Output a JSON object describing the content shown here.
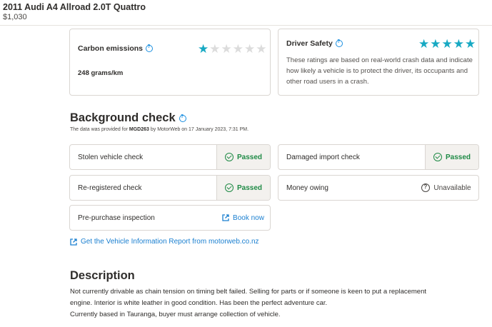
{
  "header": {
    "title": "2011 Audi A4 Allroad 2.0T Quattro",
    "price": "$1,030"
  },
  "ratings": {
    "carbon": {
      "title": "Carbon emissions",
      "value": "248 grams/km",
      "stars_filled": 1,
      "stars_total": 6
    },
    "safety": {
      "title": "Driver Safety",
      "stars_filled": 5,
      "stars_total": 5,
      "description": "These ratings are based on real-world crash data and indicate how likely a vehicle is to protect the driver, its occupants and other road users in a crash."
    }
  },
  "background_check": {
    "title": "Background check",
    "provided_prefix": "The data was provided for ",
    "plate": "MGD263",
    "provided_suffix": " by MotorWeb on 17 January 2023, 7:31 PM.",
    "items": {
      "stolen": {
        "label": "Stolen vehicle check",
        "status": "Passed"
      },
      "damaged": {
        "label": "Damaged import check",
        "status": "Passed"
      },
      "reregistered": {
        "label": "Re-registered check",
        "status": "Passed"
      },
      "money": {
        "label": "Money owing",
        "status": "Unavailable"
      },
      "inspection": {
        "label": "Pre-purchase inspection",
        "status": "Book now"
      }
    },
    "report_link": "Get the Vehicle Information Report from motorweb.co.nz"
  },
  "description": {
    "title": "Description",
    "line1": "Not currently drivable as chain tension on timing belt failed.  Selling for parts or if someone is keen to put a replacement",
    "line2": "engine.  Interior is white leather in good condition.  Has been the perfect adventure car.",
    "line3": "Currently based in Tauranga, buyer must arrange collection of vehicle."
  },
  "colors": {
    "accent": "#17a9c3",
    "link": "#1a7fd0",
    "passed": "#1e8a45"
  }
}
